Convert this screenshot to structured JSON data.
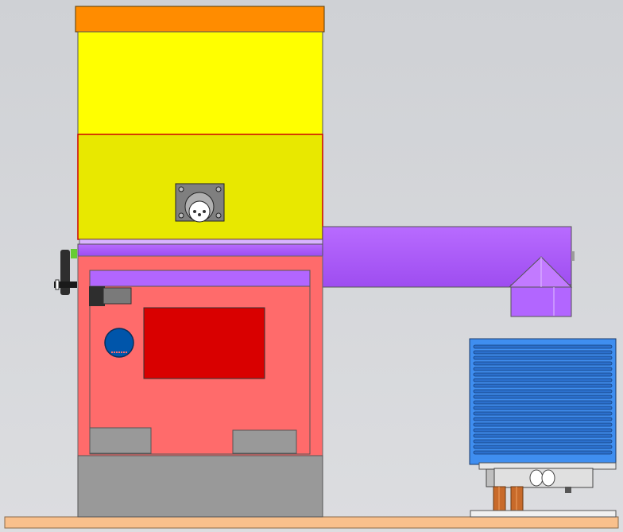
{
  "scene": {
    "background_top": "#cfd1d5",
    "background_bottom": "#dcdde0",
    "parts": [
      {
        "name": "hopper-cap",
        "color": "#ff8c00"
      },
      {
        "name": "hopper-upper-section",
        "color": "#ffff00"
      },
      {
        "name": "hopper-lower-section",
        "color": "#e8e800"
      },
      {
        "name": "circular-connector",
        "color": "#808080"
      },
      {
        "name": "feed-tube",
        "color": "#b266ff"
      },
      {
        "name": "feed-tube-elbow",
        "color": "#b266ff"
      },
      {
        "name": "mounting-bracket",
        "color": "#2e2e2e"
      },
      {
        "name": "electronics-enclosure",
        "color": "#ff6b6b"
      },
      {
        "name": "control-panel",
        "color": "#d90000"
      },
      {
        "name": "knob",
        "color": "#0055aa"
      },
      {
        "name": "base-block",
        "color": "#999999"
      },
      {
        "name": "heat-sink",
        "color": "#3f8ef0"
      },
      {
        "name": "load-cell",
        "color": "#e0e0e0"
      },
      {
        "name": "copper-legs",
        "color": "#c86a2a"
      },
      {
        "name": "base-plate",
        "color": "#f9c08c"
      }
    ]
  }
}
